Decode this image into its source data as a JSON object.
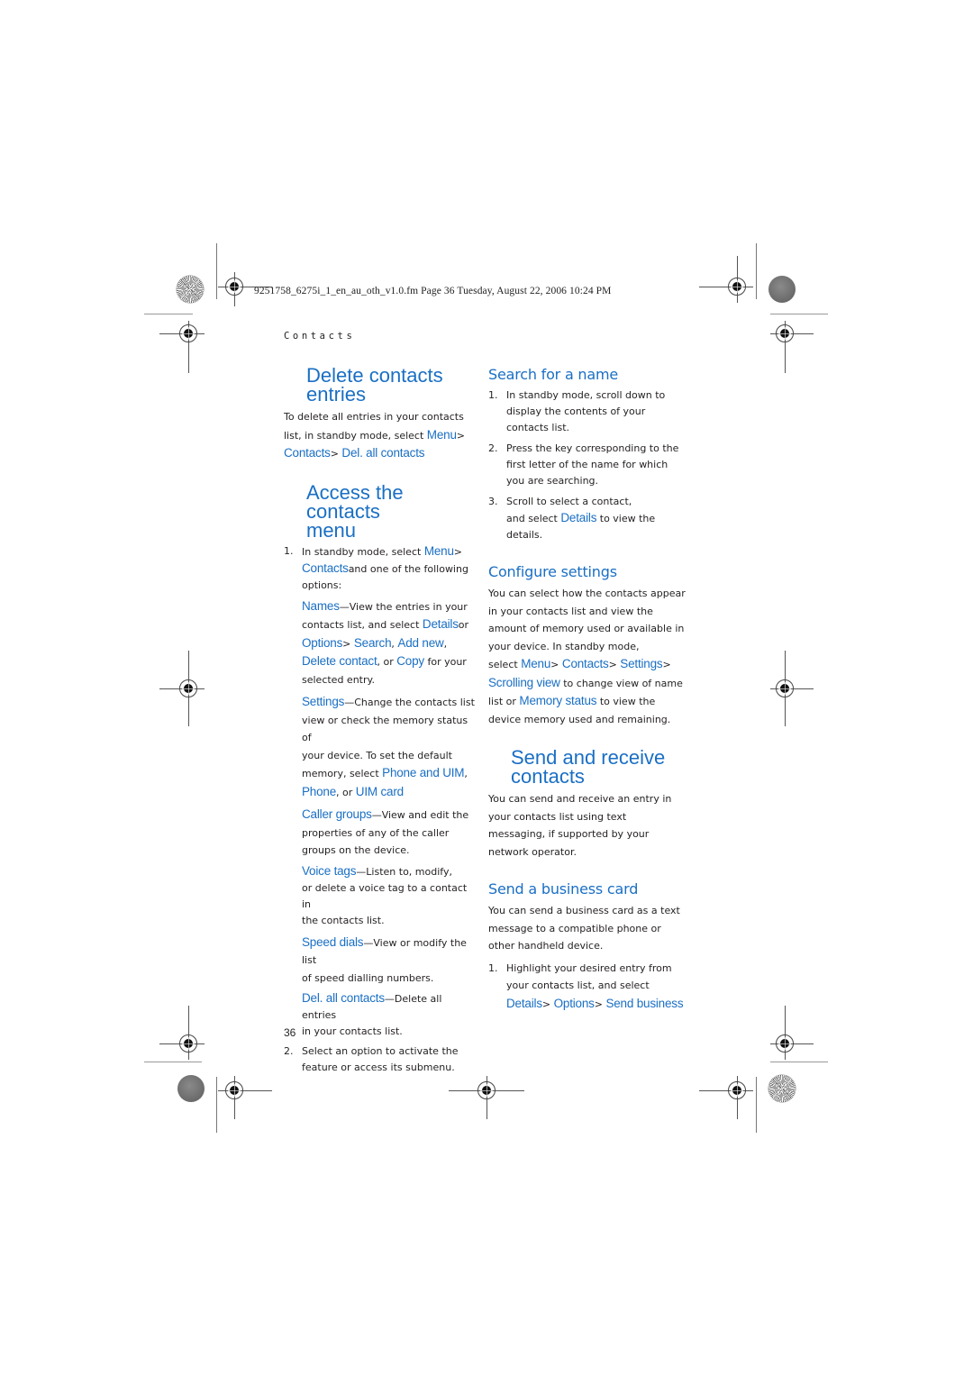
{
  "slug": "9251758_6275i_1_en_au_oth_v1.0.fm  Page 36  Tuesday, August 22, 2006  10:24 PM",
  "running_head": "Contacts",
  "page_number": "36",
  "colors": {
    "accent": "#1a6fc4",
    "body": "#231f20"
  },
  "left": {
    "delete": {
      "title_line1": "Delete contacts",
      "title_line2": "entries",
      "p1": "To delete all entries in your contacts",
      "p2": "list, in standby mode, select ",
      "menu": "Menu",
      "sep": ">",
      "contacts": "Contacts",
      "del_all": "Del. all contacts"
    },
    "access": {
      "title_line1": "Access the contacts",
      "title_line2": "menu",
      "step1_num": "1.",
      "step1_a": "In standby mode, select ",
      "step1_menu": "Menu",
      "step1_contacts": "Contacts",
      "step1_b": "and one of the following",
      "step1_c": "options:",
      "names_label": "Names",
      "names_a": "—View the entries in your",
      "names_b": "contacts list, and select ",
      "names_details": "Details",
      "names_or": "or",
      "names_options": "Options",
      "names_search": "Search",
      "names_addnew": "Add new",
      "names_delete": "Delete contact",
      "names_or2": "or ",
      "names_copy": "Copy",
      "names_c": "for your",
      "names_d": "selected entry.",
      "settings_label": "Settings",
      "settings_a": "—Change the contacts list",
      "settings_b": "view or check the memory status of",
      "settings_c": "your device. To set the default",
      "settings_d": "memory, select ",
      "settings_phone_uim": "Phone and UIM",
      "settings_phone": "Phone",
      "settings_or": "or ",
      "settings_uim": "UIM card",
      "caller_label": "Caller groups",
      "caller_a": "—View and edit the",
      "caller_b": "properties of any of the caller",
      "caller_c": "groups on the device.",
      "voice_label": "Voice tags",
      "voice_a": "—Listen to, modify,",
      "voice_b": "or delete a voice tag to a contact in",
      "voice_c": "the contacts list.",
      "speed_label": "Speed dials",
      "speed_a": "—View or modify the list",
      "speed_b": "of speed dialling numbers.",
      "delall_label": "Del. all contacts",
      "delall_a": "—Delete all entries",
      "delall_b": "in your contacts list.",
      "step2_num": "2.",
      "step2_a": "Select an option to activate the",
      "step2_b": "feature or access its submenu."
    }
  },
  "right": {
    "search": {
      "title": "Search for a name",
      "s1_num": "1.",
      "s1_a": "In standby mode, scroll down to",
      "s1_b": "display the contents of your",
      "s1_c": "contacts list.",
      "s2_num": "2.",
      "s2_a": "Press the key corresponding to the",
      "s2_b": "first letter of the name for which",
      "s2_c": "you are searching.",
      "s3_num": "3.",
      "s3_a": "Scroll to select a contact,",
      "s3_b": "and select ",
      "s3_details": "Details",
      "s3_c": "to view the",
      "s3_d": "details."
    },
    "configure": {
      "title": "Configure settings",
      "l1": "You can select how the contacts appear",
      "l2": "in your contacts list and view the",
      "l3": "amount of memory used or available in",
      "l4": "your device. In standby mode,",
      "l5": "select ",
      "menu": "Menu",
      "contacts": "Contacts",
      "settings": "Settings",
      "scrolling": "Scrolling view",
      "l6": "to change view of name",
      "l7": "list or ",
      "memory": "Memory status",
      "l7b": "to view the",
      "l8": "device memory used and remaining."
    },
    "sendrecv": {
      "title_line1": "Send and receive",
      "title_line2": "contacts",
      "l1": "You can send and receive an entry in",
      "l2": "your contacts list using text",
      "l3": "messaging, if supported by your",
      "l4": "network operator."
    },
    "bizcard": {
      "title": "Send a business card",
      "l1": "You can send a business card as a text",
      "l2": "message to a compatible phone or",
      "l3": "other handheld device.",
      "s1_num": "1.",
      "s1_a": "Highlight your desired entry from",
      "s1_b": "your contacts list, and select",
      "details": "Details",
      "options": "Options",
      "send_business": "Send business"
    }
  }
}
